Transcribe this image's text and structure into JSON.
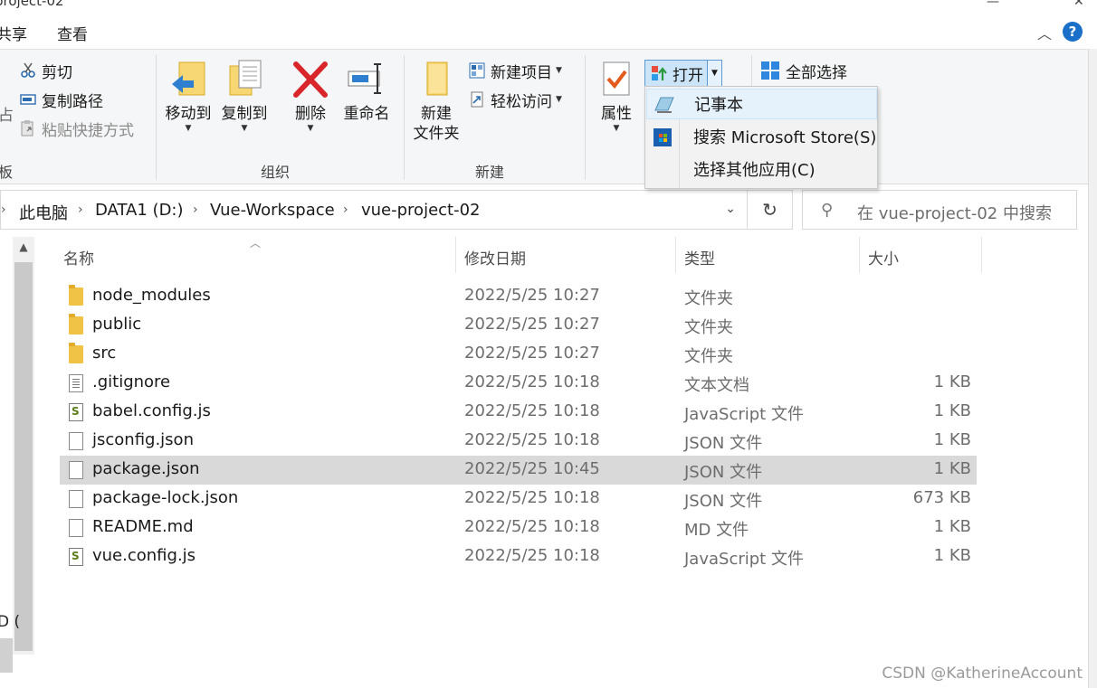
{
  "window": {
    "title_fragment": "project-02",
    "min_glyph": "—",
    "close_glyph": "✕"
  },
  "tabs": {
    "share": "共享",
    "view": "查看",
    "collapse_glyph": "︿",
    "help_glyph": "?"
  },
  "ribbon": {
    "clipboard": {
      "cut": "剪切",
      "copy_path": "复制路径",
      "paste_shortcut": "粘贴快捷方式",
      "label_fragment": "板",
      "paste_fragment": "占"
    },
    "organize": {
      "move_to": "移动到",
      "copy_to": "复制到",
      "delete": "删除",
      "rename": "重命名",
      "label": "组织"
    },
    "new": {
      "new_folder_line1": "新建",
      "new_folder_line2": "文件夹",
      "new_item": "新建项目",
      "easy_access": "轻松访问",
      "label": "新建"
    },
    "open": {
      "properties": "属性",
      "open": "打开"
    },
    "select": {
      "select_all": "全部选择"
    }
  },
  "open_menu": {
    "items": [
      {
        "label": "记事本",
        "icon": "notepad-icon"
      },
      {
        "label": "搜索 Microsoft Store(S)",
        "icon": "store-icon"
      },
      {
        "label": "选择其他应用(C)",
        "icon": ""
      }
    ]
  },
  "address": {
    "crumbs": [
      "此电脑",
      "DATA1 (D:)",
      "Vue-Workspace",
      "vue-project-02"
    ],
    "search_placeholder": "在 vue-project-02 中搜索"
  },
  "nav": {
    "stub_text": "D ("
  },
  "columns": {
    "name": "名称",
    "date": "修改日期",
    "type": "类型",
    "size": "大小"
  },
  "files": [
    {
      "name": "node_modules",
      "date": "2022/5/25 10:27",
      "type": "文件夹",
      "size": "",
      "icon": "folder-icon"
    },
    {
      "name": "public",
      "date": "2022/5/25 10:27",
      "type": "文件夹",
      "size": "",
      "icon": "folder-icon"
    },
    {
      "name": "src",
      "date": "2022/5/25 10:27",
      "type": "文件夹",
      "size": "",
      "icon": "folder-icon"
    },
    {
      "name": ".gitignore",
      "date": "2022/5/25 10:18",
      "type": "文本文档",
      "size": "1 KB",
      "icon": "text-file-icon"
    },
    {
      "name": "babel.config.js",
      "date": "2022/5/25 10:18",
      "type": "JavaScript 文件",
      "size": "1 KB",
      "icon": "js-file-icon"
    },
    {
      "name": "jsconfig.json",
      "date": "2022/5/25 10:18",
      "type": "JSON 文件",
      "size": "1 KB",
      "icon": "file-icon"
    },
    {
      "name": "package.json",
      "date": "2022/5/25 10:45",
      "type": "JSON 文件",
      "size": "1 KB",
      "icon": "file-icon",
      "selected": true
    },
    {
      "name": "package-lock.json",
      "date": "2022/5/25 10:18",
      "type": "JSON 文件",
      "size": "673 KB",
      "icon": "file-icon"
    },
    {
      "name": "README.md",
      "date": "2022/5/25 10:18",
      "type": "MD 文件",
      "size": "1 KB",
      "icon": "file-icon"
    },
    {
      "name": "vue.config.js",
      "date": "2022/5/25 10:18",
      "type": "JavaScript 文件",
      "size": "1 KB",
      "icon": "js-file-icon"
    }
  ],
  "watermark": "CSDN @KatherineAccount",
  "colors": {
    "accent": "#1a6fc9",
    "selection": "#d9d9d9",
    "hover": "#cce4f7",
    "folder": "#f0c246"
  }
}
